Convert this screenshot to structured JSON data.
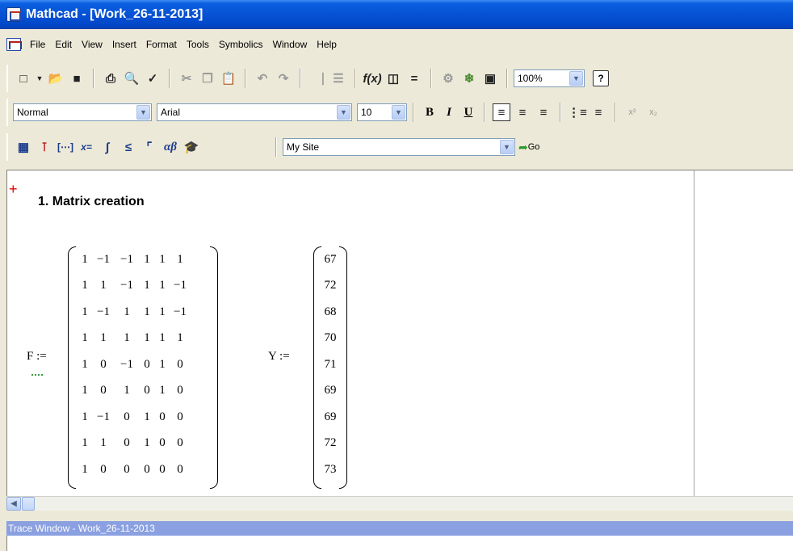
{
  "window": {
    "title": "Mathcad - [Work_26-11-2013]"
  },
  "menu": {
    "items": [
      "File",
      "Edit",
      "View",
      "Insert",
      "Format",
      "Tools",
      "Symbolics",
      "Window",
      "Help"
    ]
  },
  "standard_toolbar": {
    "zoom": "100%",
    "help_label": "?"
  },
  "formatting_toolbar": {
    "style": "Normal",
    "font": "Arial",
    "size": "10",
    "bold_label": "B",
    "italic_label": "I",
    "underline_label": "U"
  },
  "math_toolbar": {
    "site_select": "My Site",
    "go_label": "Go"
  },
  "worksheet": {
    "heading": "1. Matrix creation",
    "matrix_f": {
      "label": "F :=",
      "rows": [
        [
          "1",
          "−1",
          "−1",
          "1",
          "1",
          "1"
        ],
        [
          "1",
          "1",
          "−1",
          "1",
          "1",
          "−1"
        ],
        [
          "1",
          "−1",
          "1",
          "1",
          "1",
          "−1"
        ],
        [
          "1",
          "1",
          "1",
          "1",
          "1",
          "1"
        ],
        [
          "1",
          "0",
          "−1",
          "0",
          "1",
          "0"
        ],
        [
          "1",
          "0",
          "1",
          "0",
          "1",
          "0"
        ],
        [
          "1",
          "−1",
          "0",
          "1",
          "0",
          "0"
        ],
        [
          "1",
          "1",
          "0",
          "1",
          "0",
          "0"
        ],
        [
          "1",
          "0",
          "0",
          "0",
          "0",
          "0"
        ]
      ]
    },
    "vector_y": {
      "label": "Y :=",
      "values": [
        "67",
        "72",
        "68",
        "70",
        "71",
        "69",
        "69",
        "72",
        "73"
      ]
    }
  },
  "trace_window": {
    "title": "Trace Window - Work_26-11-2013"
  }
}
